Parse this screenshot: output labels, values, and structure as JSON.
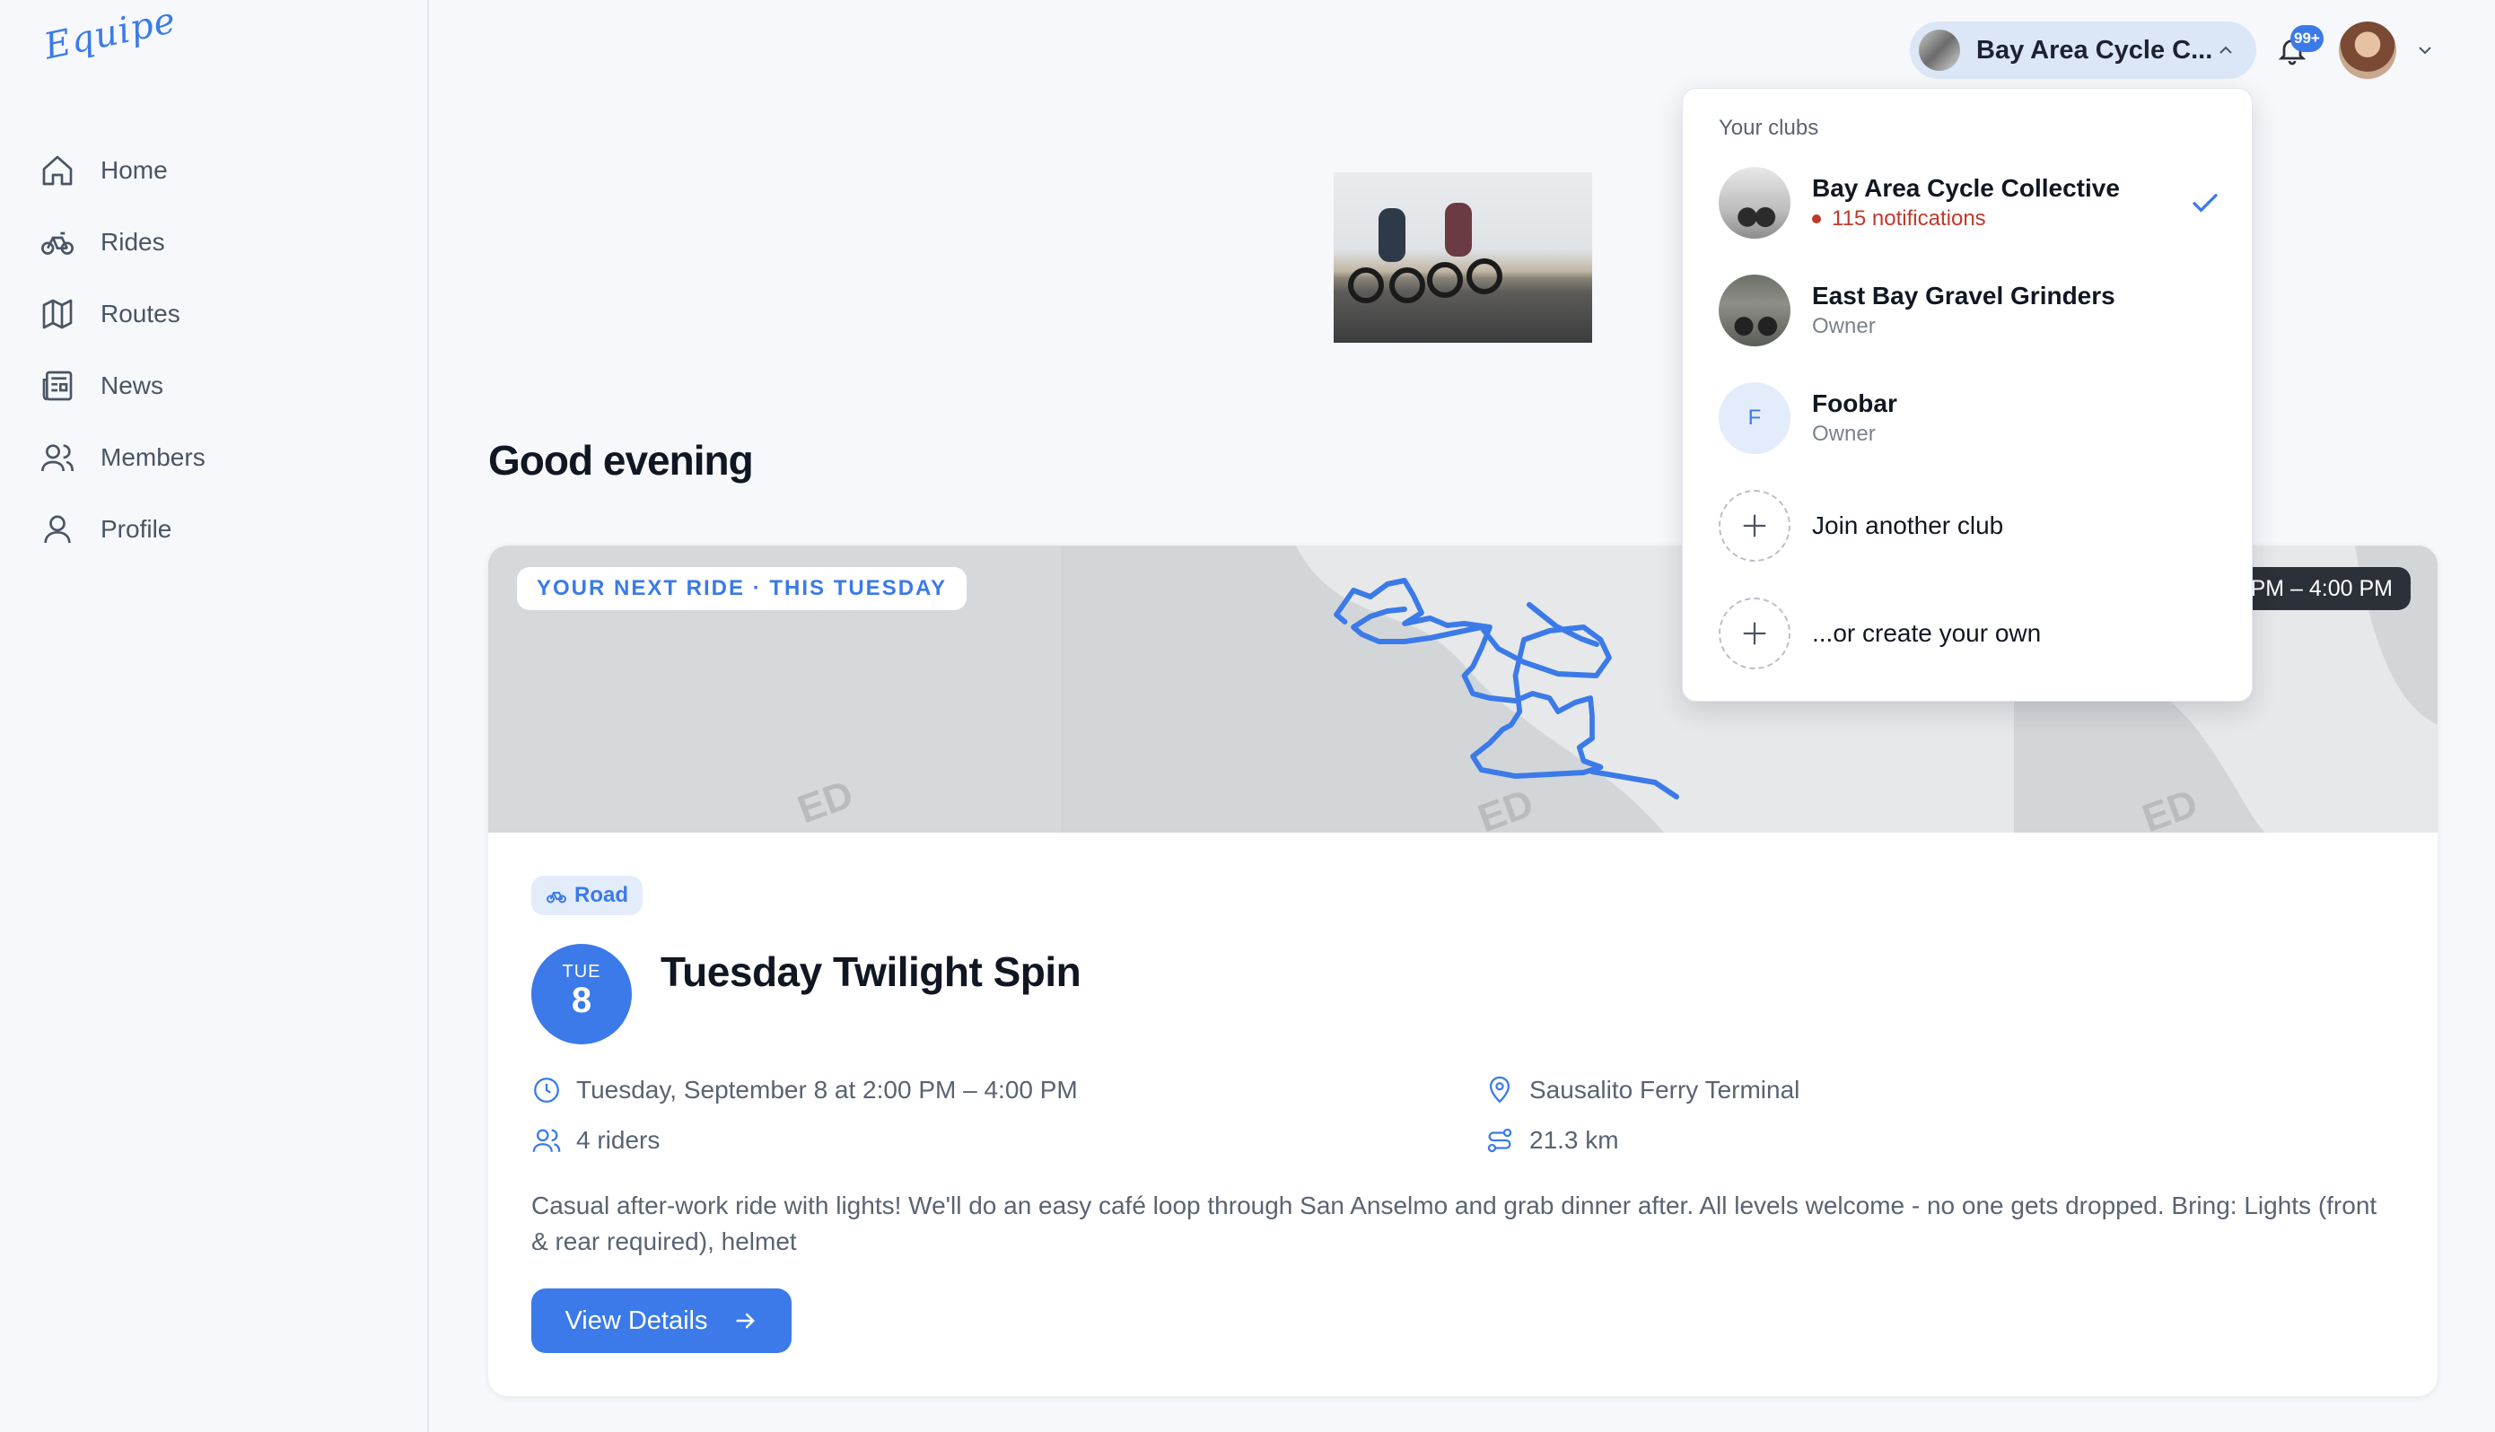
{
  "app": {
    "logo": "Equipe"
  },
  "sidebar": {
    "items": [
      {
        "label": "Home",
        "icon": "home-icon"
      },
      {
        "label": "Rides",
        "icon": "bicycle-icon"
      },
      {
        "label": "Routes",
        "icon": "map-icon"
      },
      {
        "label": "News",
        "icon": "newspaper-icon"
      },
      {
        "label": "Members",
        "icon": "users-icon"
      },
      {
        "label": "Profile",
        "icon": "user-icon"
      }
    ]
  },
  "header": {
    "club_selector_label": "Bay Area Cycle C...",
    "notifications_badge": "99+"
  },
  "main": {
    "greeting": "Good evening",
    "next_ride": {
      "label": "YOUR NEXT RIDE · THIS TUESDAY",
      "time_chip": "PM – 4:00 PM",
      "tag": "Road",
      "date_dow": "TUE",
      "date_day": "8",
      "title": "Tuesday Twilight Spin",
      "datetime": "Tuesday, September 8 at 2:00 PM – 4:00 PM",
      "location": "Sausalito Ferry Terminal",
      "riders": "4 riders",
      "distance": "21.3 km",
      "description": "Casual after-work ride with lights! We'll do an easy café loop through San Anselmo and grab dinner after. All levels welcome - no one gets dropped. Bring: Lights (front & rear required), helmet",
      "button": "View Details"
    }
  },
  "dropdown": {
    "heading": "Your clubs",
    "clubs": [
      {
        "name": "Bay Area Cycle Collective",
        "subtitle": "115 notifications",
        "selected": true
      },
      {
        "name": "East Bay Gravel Grinders",
        "subtitle": "Owner"
      },
      {
        "name": "Foobar",
        "subtitle": "Owner",
        "initial": "F"
      }
    ],
    "actions": [
      {
        "label": "Join another club"
      },
      {
        "label": "...or create your own"
      }
    ]
  },
  "colors": {
    "accent": "#3b7ae8",
    "notification": "#c0392b"
  }
}
